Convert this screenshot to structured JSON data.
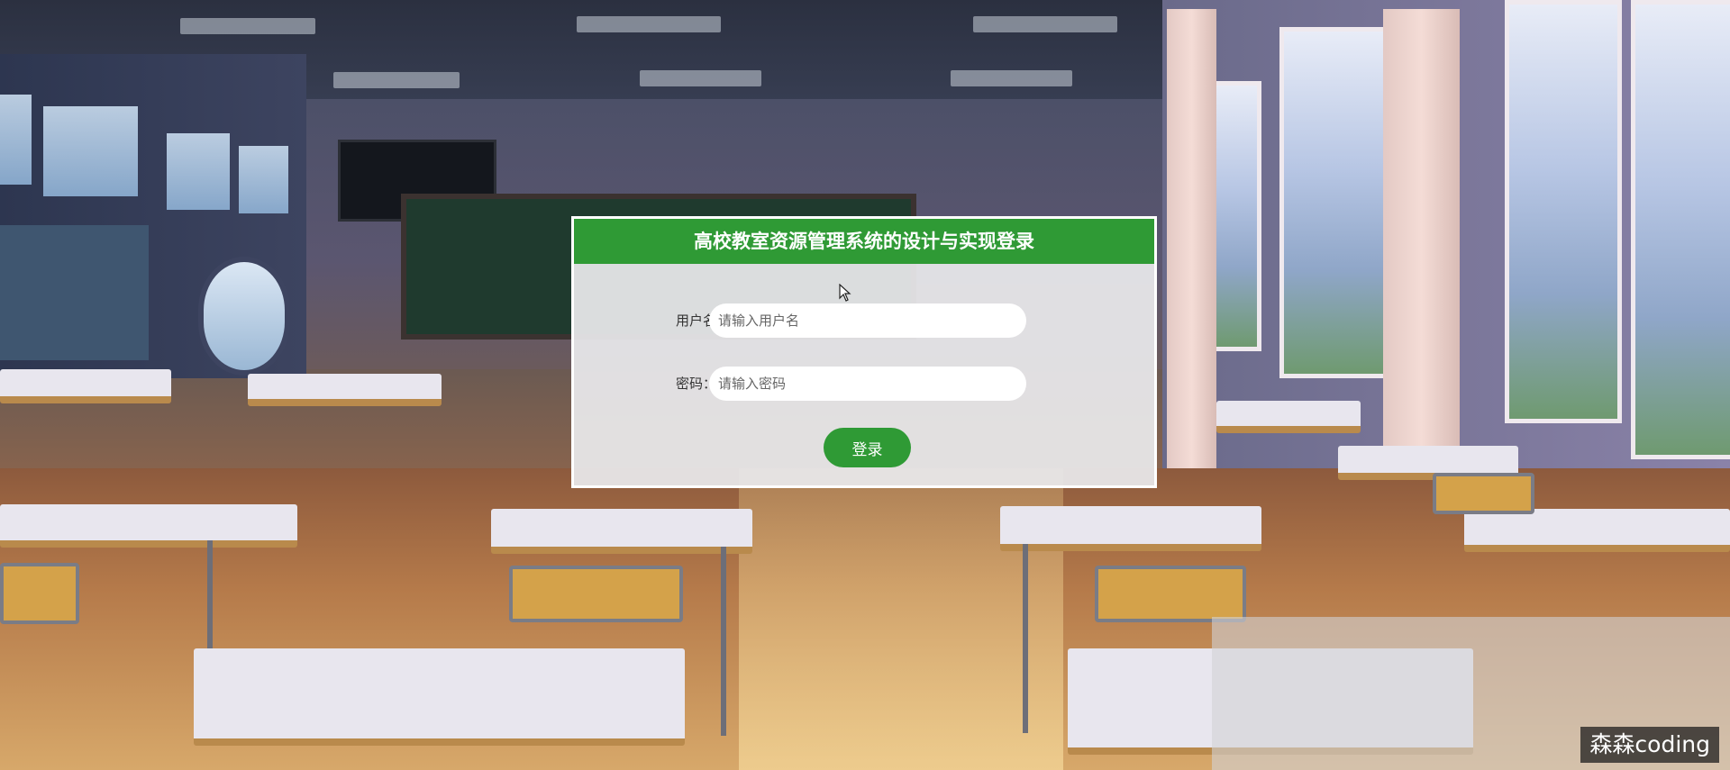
{
  "login": {
    "title": "高校教室资源管理系统的设计与实现登录",
    "username_label": "用户名",
    "username_placeholder": "请输入用户名",
    "username_value": "",
    "password_label": "密码：",
    "password_placeholder": "请输入密码",
    "password_value": "",
    "submit_label": "登录"
  },
  "watermark": {
    "text": "森森coding"
  },
  "colors": {
    "accent_green": "#2f9a35",
    "panel_bg": "#e9e9ec",
    "input_bg": "#ffffff"
  },
  "icons": {
    "cursor": "mouse-pointer-icon"
  }
}
